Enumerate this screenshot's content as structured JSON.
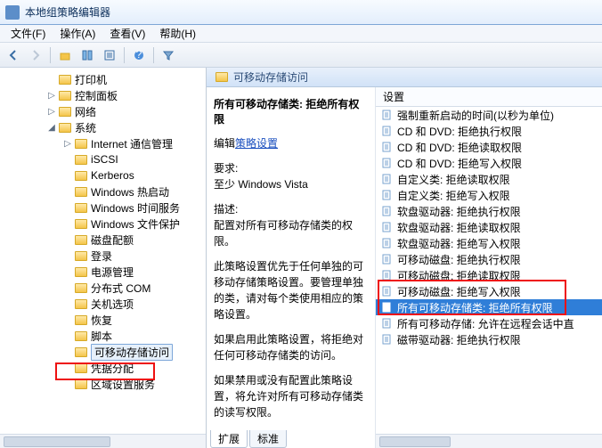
{
  "window": {
    "title": "本地组策略编辑器"
  },
  "menu": {
    "file": "文件(F)",
    "action": "操作(A)",
    "view": "查看(V)",
    "help": "帮助(H)"
  },
  "tree": {
    "items": [
      {
        "indent": 2,
        "exp": "",
        "label": "打印机"
      },
      {
        "indent": 2,
        "exp": "▷",
        "label": "控制面板"
      },
      {
        "indent": 2,
        "exp": "▷",
        "label": "网络"
      },
      {
        "indent": 2,
        "exp": "◢",
        "label": "系统"
      },
      {
        "indent": 3,
        "exp": "▷",
        "label": "Internet 通信管理"
      },
      {
        "indent": 3,
        "exp": "",
        "label": "iSCSI"
      },
      {
        "indent": 3,
        "exp": "",
        "label": "Kerberos"
      },
      {
        "indent": 3,
        "exp": "",
        "label": "Windows 热启动"
      },
      {
        "indent": 3,
        "exp": "",
        "label": "Windows 时间服务"
      },
      {
        "indent": 3,
        "exp": "",
        "label": "Windows 文件保护"
      },
      {
        "indent": 3,
        "exp": "",
        "label": "磁盘配额"
      },
      {
        "indent": 3,
        "exp": "",
        "label": "登录"
      },
      {
        "indent": 3,
        "exp": "",
        "label": "电源管理"
      },
      {
        "indent": 3,
        "exp": "",
        "label": "分布式 COM"
      },
      {
        "indent": 3,
        "exp": "",
        "label": "关机选项"
      },
      {
        "indent": 3,
        "exp": "",
        "label": "恢复"
      },
      {
        "indent": 3,
        "exp": "",
        "label": "脚本"
      },
      {
        "indent": 3,
        "exp": "",
        "label": "可移动存储访问",
        "selected": true
      },
      {
        "indent": 3,
        "exp": "",
        "label": "凭据分配"
      },
      {
        "indent": 3,
        "exp": "",
        "label": "区域设置服务"
      }
    ]
  },
  "content": {
    "header": "可移动存储访问",
    "titleLine": "所有可移动存储类: 拒绝所有权限",
    "editPrefix": "编辑",
    "editLink": "策略设置",
    "reqLabel": "要求:",
    "reqValue": "至少 Windows Vista",
    "descLabel": "描述:",
    "desc1": "配置对所有可移动存储类的权限。",
    "desc2": "此策略设置优先于任何单独的可移动存储策略设置。要管理单独的类，请对每个类使用相应的策略设置。",
    "desc3": "如果启用此策略设置，将拒绝对任何可移动存储类的访问。",
    "desc4": "如果禁用或没有配置此策略设置，将允许对所有可移动存储类的读写权限。"
  },
  "settingsCol": "设置",
  "settings": [
    "强制重新启动的时间(以秒为单位)",
    "CD 和 DVD: 拒绝执行权限",
    "CD 和 DVD: 拒绝读取权限",
    "CD 和 DVD: 拒绝写入权限",
    "自定义类: 拒绝读取权限",
    "自定义类: 拒绝写入权限",
    "软盘驱动器: 拒绝执行权限",
    "软盘驱动器: 拒绝读取权限",
    "软盘驱动器: 拒绝写入权限",
    "可移动磁盘: 拒绝执行权限",
    "可移动磁盘: 拒绝读取权限",
    "可移动磁盘: 拒绝写入权限",
    "所有可移动存储类: 拒绝所有权限",
    "所有可移动存储: 允许在远程会话中直",
    "磁带驱动器: 拒绝执行权限"
  ],
  "selectedSettingIndex": 12,
  "tabs": {
    "extended": "扩展",
    "standard": "标准"
  }
}
